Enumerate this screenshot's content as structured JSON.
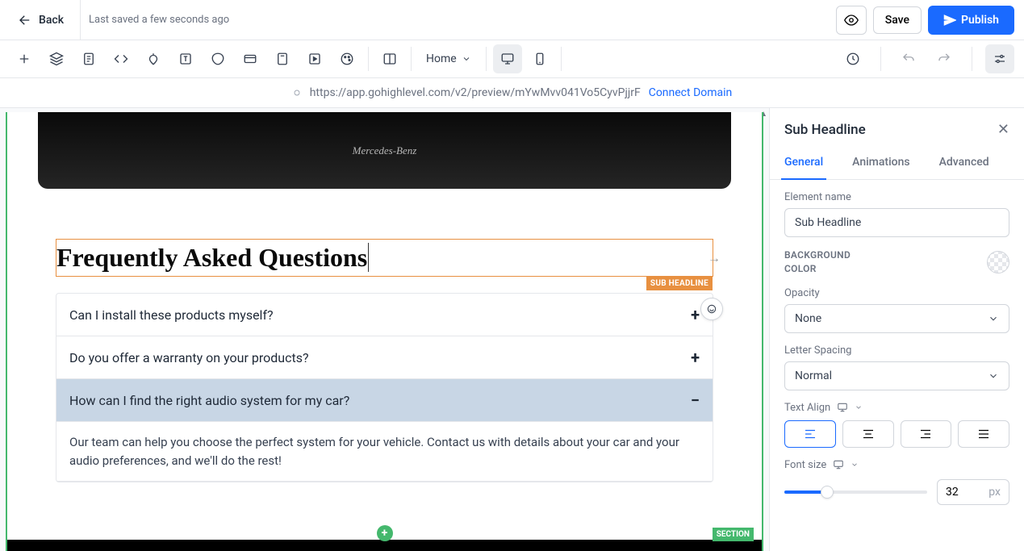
{
  "topbar": {
    "back": "Back",
    "status": "Last saved a few seconds ago",
    "save": "Save",
    "publish": "Publish"
  },
  "toolbar": {
    "page": "Home"
  },
  "urlbar": {
    "url": "https://app.gohighlevel.com/v2/preview/mYwMvv041Vo5CyvPjjrF",
    "connect": "Connect Domain"
  },
  "canvas": {
    "hero_brand": "Mercedes-Benz",
    "headline": "Frequently Asked Questions",
    "headline_tag": "SUB HEADLINE",
    "section_tag": "SECTION",
    "faq": [
      {
        "q": "Can I install these products myself?",
        "expanded": false
      },
      {
        "q": "Do you offer a warranty on your products?",
        "expanded": false
      },
      {
        "q": "How can I find the right audio system for my car?",
        "expanded": true,
        "a": "Our team can help you choose the perfect system for your vehicle. Contact us with details about your car and your audio preferences, and we'll do the rest!"
      }
    ]
  },
  "sidepanel": {
    "title": "Sub Headline",
    "tabs": {
      "general": "General",
      "animations": "Animations",
      "advanced": "Advanced"
    },
    "labels": {
      "element_name": "Element name",
      "bg_color": "BACKGROUND COLOR",
      "opacity": "Opacity",
      "letter_spacing": "Letter Spacing",
      "text_align": "Text Align",
      "font_size": "Font size"
    },
    "values": {
      "element_name": "Sub Headline",
      "opacity": "None",
      "letter_spacing": "Normal",
      "font_size": "32",
      "font_unit": "px"
    }
  }
}
